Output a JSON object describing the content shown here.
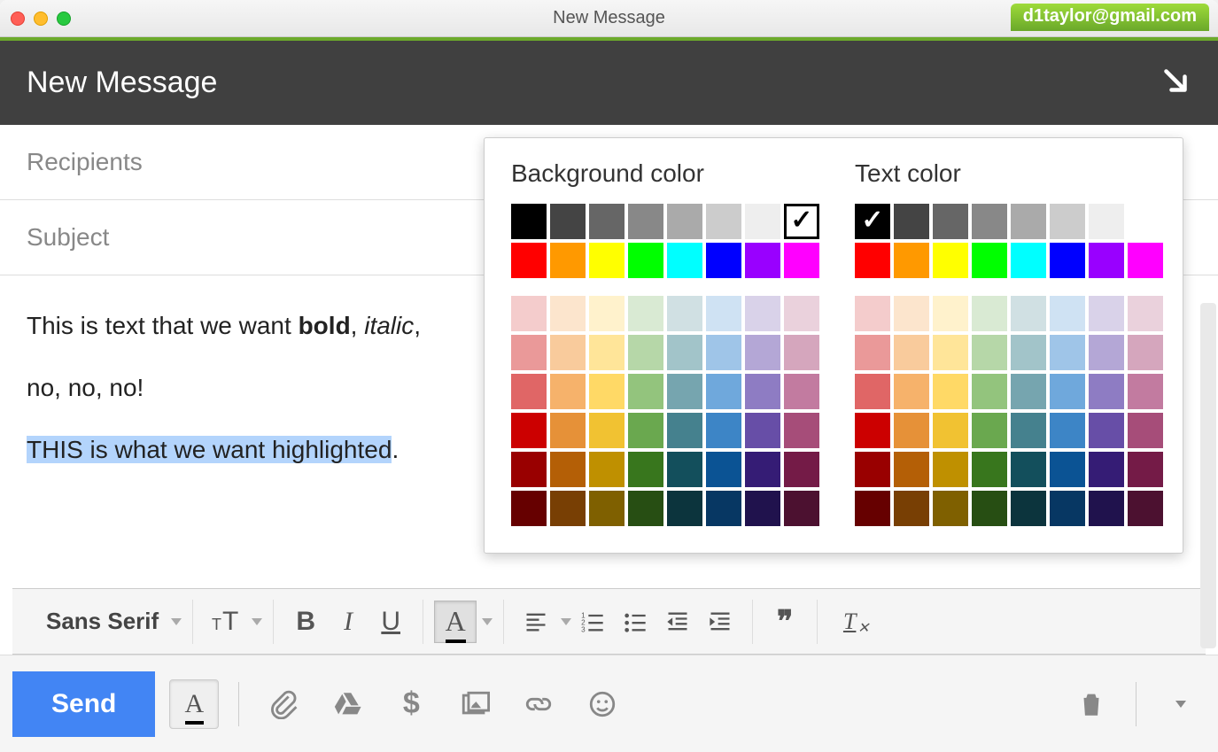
{
  "window": {
    "title": "New Message",
    "account": "d1taylor@gmail.com"
  },
  "header": {
    "title": "New Message"
  },
  "fields": {
    "recipients": "Recipients",
    "subject": "Subject"
  },
  "body": {
    "line1_prefix": "This is text that we want ",
    "line1_bold": "bold",
    "line1_mid": ", ",
    "line1_italic": "italic",
    "line1_suffix": ",",
    "line2": "no, no, no!",
    "line3_highlight": "THIS is what we want highlighted",
    "line3_suffix": "."
  },
  "toolbar": {
    "font": "Sans Serif"
  },
  "bottombar": {
    "send": "Send"
  },
  "color_popup": {
    "bg_title": "Background color",
    "text_title": "Text color",
    "gray_row": [
      "#000000",
      "#444444",
      "#666666",
      "#888888",
      "#aaaaaa",
      "#cccccc",
      "#eeeeee",
      "#ffffff"
    ],
    "bright_row": [
      "#ff0000",
      "#ff9900",
      "#ffff00",
      "#00ff00",
      "#00ffff",
      "#0000ff",
      "#9900ff",
      "#ff00ff"
    ],
    "matrix": [
      [
        "#f4cccc",
        "#fce5cd",
        "#fff2cc",
        "#d9ead3",
        "#d0e0e3",
        "#cfe2f3",
        "#d9d2e9",
        "#ead1dc"
      ],
      [
        "#ea9999",
        "#f9cb9c",
        "#ffe599",
        "#b6d7a8",
        "#a2c4c9",
        "#9fc5e8",
        "#b4a7d6",
        "#d5a6bd"
      ],
      [
        "#e06666",
        "#f6b26b",
        "#ffd966",
        "#93c47d",
        "#76a5af",
        "#6fa8dc",
        "#8e7cc3",
        "#c27ba0"
      ],
      [
        "#cc0000",
        "#e69138",
        "#f1c232",
        "#6aa84f",
        "#45818e",
        "#3d85c6",
        "#674ea7",
        "#a64d79"
      ],
      [
        "#990000",
        "#b45f06",
        "#bf9000",
        "#38761d",
        "#134f5c",
        "#0b5394",
        "#351c75",
        "#741b47"
      ],
      [
        "#660000",
        "#783f04",
        "#7f6000",
        "#274e13",
        "#0c343d",
        "#073763",
        "#20124d",
        "#4c1130"
      ]
    ],
    "bg_selected_index": 7,
    "text_selected_index": 0
  }
}
